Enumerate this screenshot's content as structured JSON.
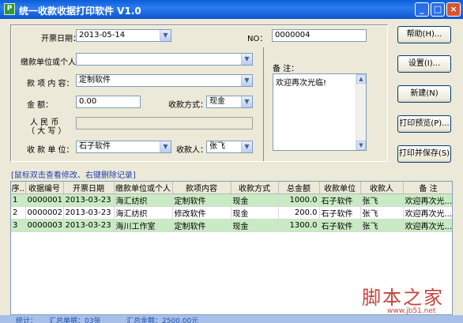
{
  "window": {
    "icon_glyph": "P",
    "title": "统一收款收据打印软件 V1.0",
    "minimize": "_",
    "maximize": "□",
    "close": "×"
  },
  "form": {
    "date_label": "开票日期：",
    "date_value": "2013-05-14",
    "no_label": "NO：",
    "no_value": "0000004",
    "payer_label": "缴款单位或个人：",
    "payer_value": "",
    "item_label": "款 项 内 容：",
    "item_value": "定制软件",
    "amount_label": "金        额：",
    "amount_value": "0.00",
    "method_label": "收款方式：",
    "method_value": "现金",
    "rmb_label_1": "人 民 币",
    "rmb_label_2": "（ 大  写 ）",
    "rmb_value": "",
    "unit_label": "收 款 单 位：",
    "unit_value": "石子软件",
    "payee_label": "收款人：",
    "payee_value": "张飞",
    "note_label": "备 注：",
    "note_value": "欢迎再次光临!"
  },
  "buttons": {
    "help": "帮助(H)...",
    "settings": "设置(I)...",
    "new": "新建(N)",
    "preview": "打印预览(P)...",
    "print_save": "打印并保存(S)"
  },
  "hint": "[鼠标双击查看修改、右键删除记录]",
  "table": {
    "columns": [
      "序..",
      "收据编号",
      "开票日期",
      "缴款单位或个人",
      "款项内容",
      "收款方式",
      "总金额",
      "收款单位",
      "收款人",
      "备 注"
    ],
    "rows": [
      [
        "1",
        "0000001",
        "2013-03-23 ...",
        "海汇纺织",
        "定制软件",
        "现金",
        "1000.0",
        "石子软件",
        "张飞",
        "欢迎再次光..."
      ],
      [
        "2",
        "0000002",
        "2013-03-23 ...",
        "海汇纺织",
        "修改软件",
        "现金",
        "200.0",
        "石子软件",
        "张飞",
        "欢迎再次光..."
      ],
      [
        "3",
        "0000003",
        "2013-03-23 ...",
        "海川工作室",
        "定制软件",
        "现金",
        "1300.0",
        "石子软件",
        "张飞",
        "欢迎再次光..."
      ]
    ]
  },
  "status": {
    "label": "统计：",
    "count": "汇总单据：03张",
    "total": "汇总金额：2500.00元"
  },
  "watermark": {
    "text": "脚本之家",
    "url": "www.jb51.net"
  },
  "colors": {
    "titlebar": "#0a5fd8",
    "row_highlight": "#c9ebc3",
    "hint_text": "#1f3fb0",
    "watermark": "#c4453c"
  }
}
